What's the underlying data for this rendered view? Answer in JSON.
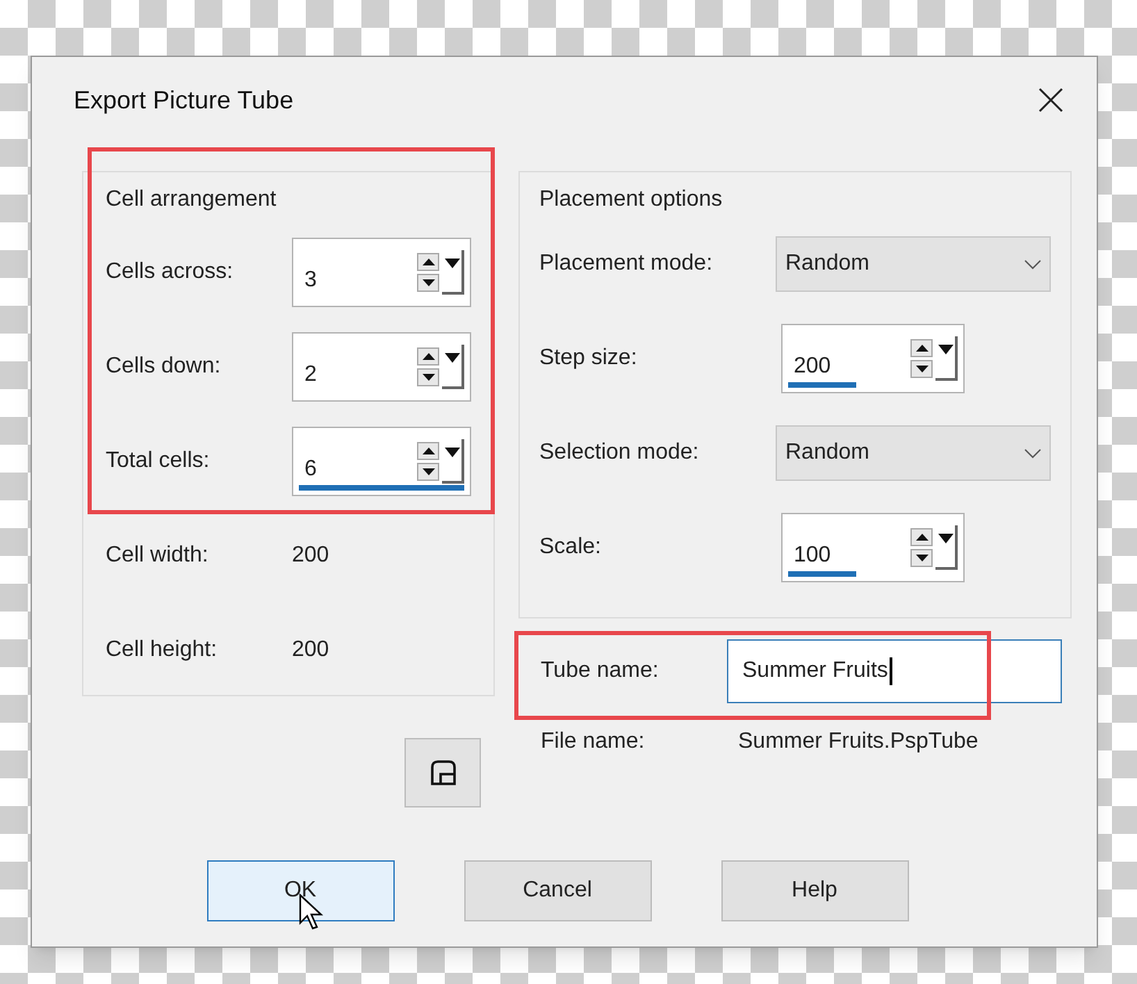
{
  "window": {
    "title": "Export Picture Tube"
  },
  "cell_arrangement": {
    "title": "Cell arrangement",
    "fields": [
      {
        "kind": "spinner",
        "label": "Cells across:",
        "value": "3"
      },
      {
        "kind": "spinner",
        "label": "Cells down:",
        "value": "2"
      },
      {
        "kind": "spinner",
        "label": "Total cells:",
        "value": "6",
        "level": 1
      },
      {
        "kind": "readout",
        "label": "Cell width:",
        "value": "200"
      },
      {
        "kind": "readout",
        "label": "Cell height:",
        "value": "200"
      }
    ]
  },
  "placement_options": {
    "title": "Placement options",
    "fields": [
      {
        "kind": "dropdown",
        "label": "Placement mode:",
        "value": "Random"
      },
      {
        "kind": "spinner",
        "label": "Step size:",
        "value": "200",
        "level": 0.4
      },
      {
        "kind": "dropdown",
        "label": "Selection mode:",
        "value": "Random"
      },
      {
        "kind": "spinner",
        "label": "Scale:",
        "value": "100",
        "level": 0.4
      }
    ]
  },
  "tube_name": {
    "label": "Tube name:",
    "value": "Summer Fruits"
  },
  "file_name": {
    "label": "File name:",
    "value": "Summer Fruits.PspTube"
  },
  "buttons": [
    {
      "label": "OK",
      "default": true
    },
    {
      "label": "Cancel",
      "default": false
    },
    {
      "label": "Help",
      "default": false
    }
  ]
}
